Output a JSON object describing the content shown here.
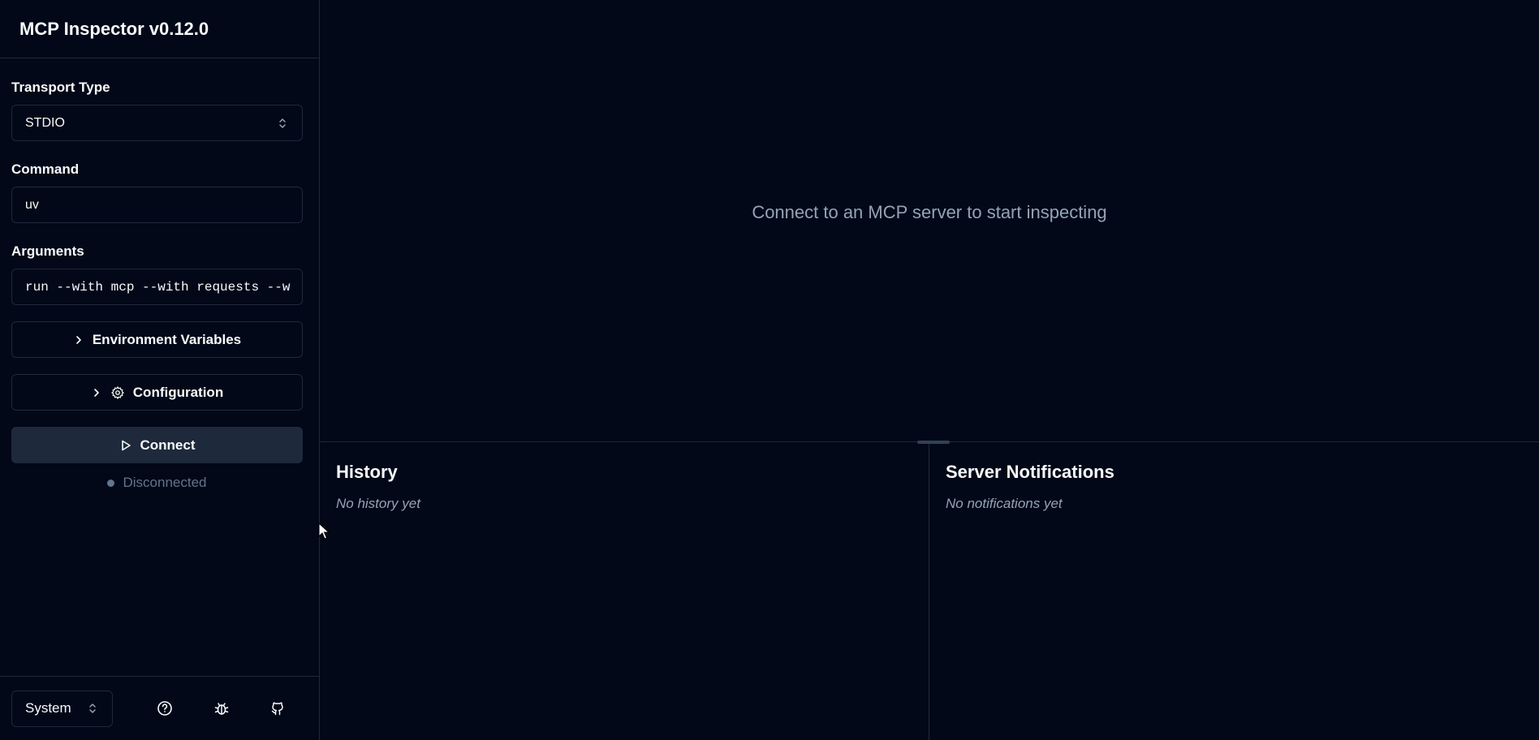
{
  "app": {
    "title": "MCP Inspector v0.12.0"
  },
  "sidebar": {
    "transport": {
      "label": "Transport Type",
      "value": "STDIO"
    },
    "command": {
      "label": "Command",
      "value": "uv"
    },
    "arguments": {
      "label": "Arguments",
      "value": "run --with mcp --with requests --w"
    },
    "env_vars": {
      "label": "Environment Variables",
      "icon": "chevron-right-icon"
    },
    "configuration": {
      "label": "Configuration",
      "icon": "gear-icon"
    },
    "connect": {
      "label": "Connect",
      "icon": "play-icon"
    },
    "status": {
      "label": "Disconnected",
      "color": "#64748b"
    },
    "footer": {
      "theme": "System",
      "icons": [
        "help-icon",
        "bug-icon",
        "github-icon"
      ]
    }
  },
  "main": {
    "placeholder": "Connect to an MCP server to start inspecting",
    "history": {
      "title": "History",
      "empty": "No history yet"
    },
    "notifications": {
      "title": "Server Notifications",
      "empty": "No notifications yet"
    }
  },
  "colors": {
    "background": "#020817",
    "border": "#1e293b",
    "muted": "#94a3b8",
    "button": "#1e293b"
  }
}
